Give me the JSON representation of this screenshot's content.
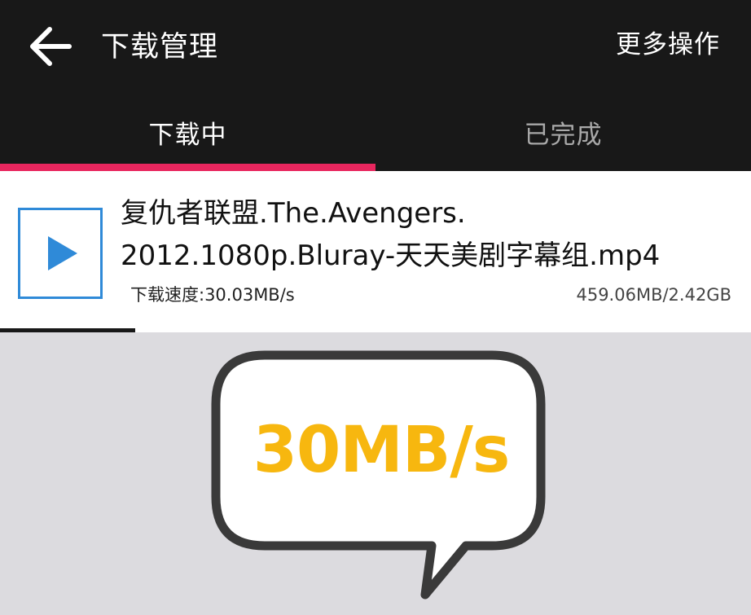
{
  "header": {
    "back_icon": "arrow-left-icon",
    "title": "下载管理",
    "more_label": "更多操作"
  },
  "tabs": [
    {
      "label": "下载中",
      "active": true
    },
    {
      "label": "已完成",
      "active": false
    }
  ],
  "colors": {
    "header_bg": "#181818",
    "tab_indicator": "#e8265e",
    "play_icon": "#2f8ad8",
    "callout_text": "#f7b70f"
  },
  "downloads": [
    {
      "icon": "play-icon",
      "name_line1": "复仇者联盟.The.Avengers.",
      "name_line2": "2012.1080p.Bluray-天天美剧字幕组.mp4",
      "speed": "下载速度:30.03MB/s",
      "size": "459.06MB/2.42GB",
      "progress": 0.18
    }
  ],
  "callout": {
    "text": "30MB/s"
  }
}
